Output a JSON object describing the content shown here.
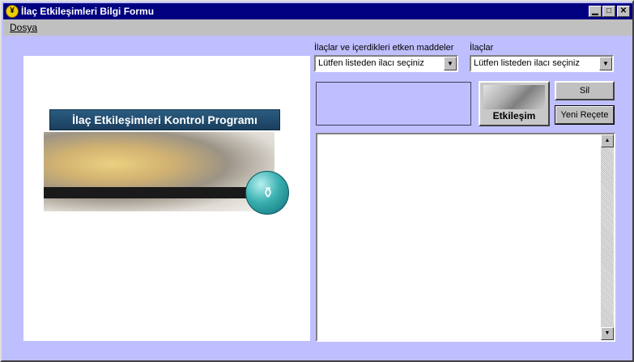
{
  "window": {
    "title": "İlaç Etkileşimleri Bilgi Formu",
    "icon": "app-icon",
    "minimize_glyph": "▁",
    "maximize_glyph": "□",
    "close_glyph": "✕"
  },
  "menu": {
    "items": [
      {
        "label": "Dosya"
      }
    ]
  },
  "logo": {
    "banner_text": "İlaç Etkileşimleri Kontrol Programı",
    "ball_glyph": "⚱"
  },
  "form": {
    "combo1": {
      "label": "İlaçlar ve içerdikleri etken maddeler",
      "value": "Lütfen listeden ilacı seçiniz"
    },
    "combo2": {
      "label": "İlaçlar",
      "value": "Lütfen listeden ilacı seçiniz"
    },
    "arrow_glyph": "▼"
  },
  "buttons": {
    "etkilesim": "Etkileşim",
    "sil": "Sil",
    "yeni_recete": "Yeni Reçete"
  },
  "scrollbar": {
    "up_glyph": "▲",
    "down_glyph": "▼"
  }
}
